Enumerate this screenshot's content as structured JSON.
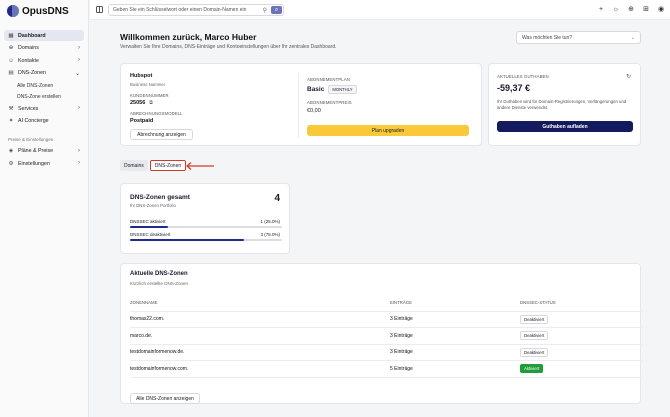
{
  "app": {
    "name": "OpusDNS"
  },
  "sidebar": {
    "items": [
      {
        "label": "Dashboard"
      },
      {
        "label": "Domains"
      },
      {
        "label": "Kontakte"
      },
      {
        "label": "DNS-Zonen"
      },
      {
        "label": "Services"
      },
      {
        "label": "AI Concierge"
      }
    ],
    "dns_sub": [
      "Alle DNS-Zonen",
      "DNS-Zone erstellen"
    ],
    "section": "Preise & Einstellungen",
    "items2": [
      {
        "label": "Pläne & Preise"
      },
      {
        "label": "Einstellungen"
      }
    ]
  },
  "topbar": {
    "search_placeholder": "Geben Sie ein Schlüsselwort oder einen Domain-Namen ein"
  },
  "header": {
    "title": "Willkommen zurück, Marco Huber",
    "subtitle": "Verwalten Sie Ihre Domains, DNS-Einträge und Kontoeinstellungen über Ihr zentrales Dashboard.",
    "ask": "Was möchten Sie tun?"
  },
  "account": {
    "company": "Hubspot",
    "company_sub": "Business Nummer",
    "customer_number_label": "KUNDENNUMMER",
    "customer_number": "25056",
    "billing_model_label": "ABRECHNUNGSMODELL",
    "billing_model": "Postpaid",
    "billing_button": "Abrechnung anzeigen",
    "plan_label": "ABONNEMENTPLAN",
    "plan": "Basic",
    "plan_period": "MONTHLY",
    "price_label": "ABONNEMENTPREIS",
    "price": "€0,00",
    "upgrade_button": "Plan upgraden"
  },
  "balance": {
    "label": "AKTUELLES GUTHABEN",
    "value": "-59,37 €",
    "description": "Ihr Guthaben wird für Domain-Registrierungen, Verlängerungen und andere Dienste verwendet.",
    "button": "Guthaben aufladen"
  },
  "tabs": [
    "Domains",
    "DNS-Zonen"
  ],
  "dns_total": {
    "title": "DNS-Zonen gesamt",
    "subtitle": "Ihr DNS-Zonen Portfolio",
    "count": "4",
    "rows": [
      {
        "label": "DNSSEC aktiviert",
        "value": "1 (25.0%)",
        "percent": 25
      },
      {
        "label": "DNSSEC deaktiviert",
        "value": "3 (75.0%)",
        "percent": 75
      }
    ]
  },
  "recent": {
    "title": "Aktuelle DNS-Zonen",
    "subtitle": "Kürzlich erstellte DNS-Zonen",
    "columns": [
      "ZONENNAME",
      "EINTRÄGE",
      "DNSSEC-STATUS"
    ],
    "rows": [
      {
        "zone": "thomas22.com.",
        "entries": "3 Einträge",
        "status": "Deaktiviert",
        "active": false
      },
      {
        "zone": "marco.de.",
        "entries": "3 Einträge",
        "status": "Deaktiviert",
        "active": false
      },
      {
        "zone": "testdomainformenow.de.",
        "entries": "3 Einträge",
        "status": "Deaktiviert",
        "active": false
      },
      {
        "zone": "testdomainformenow.com.",
        "entries": "5 Einträge",
        "status": "Aktiviert",
        "active": true
      }
    ],
    "button": "Alle DNS-Zonen anzeigen"
  },
  "colors": {
    "brand": "#1f2a8c",
    "upgrade": "#f9c93a",
    "active_badge": "#1f9d3a",
    "highlight": "#d23a2a"
  }
}
